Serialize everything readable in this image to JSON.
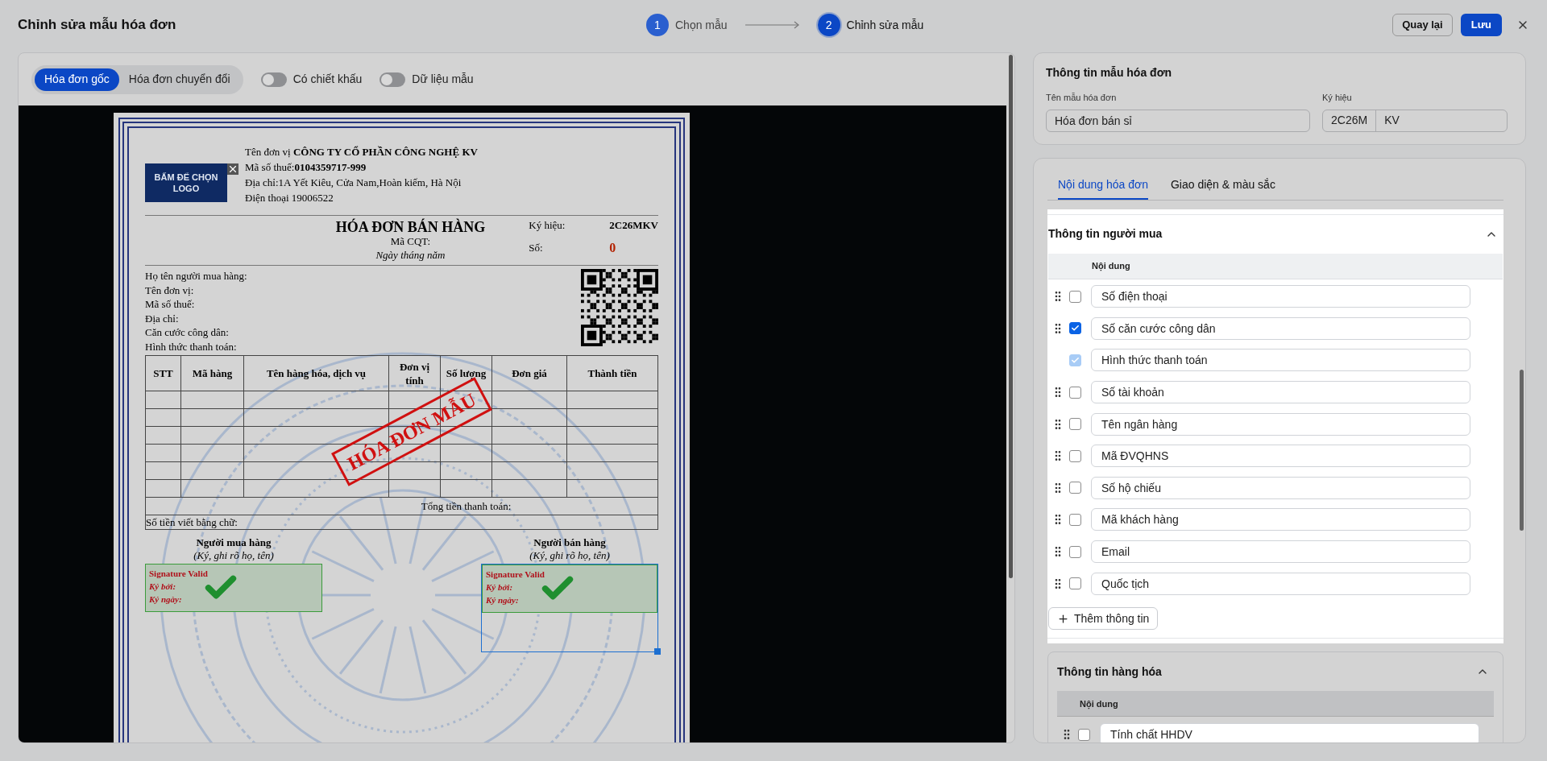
{
  "header": {
    "title": "Chỉnh sửa mẫu hóa đơn",
    "steps": [
      {
        "number": "1",
        "label": "Chọn mẫu",
        "selected": false
      },
      {
        "number": "2",
        "label": "Chỉnh sửa mẫu",
        "selected": true
      }
    ],
    "back_button": "Quay lại",
    "save_button": "Lưu"
  },
  "preview": {
    "modes": [
      {
        "label": "Hóa đơn gốc",
        "selected": true
      },
      {
        "label": "Hóa đơn chuyển đổi",
        "selected": false
      }
    ],
    "switches": [
      {
        "label": "Có chiết khấu",
        "on": false
      },
      {
        "label": "Dữ liệu mẫu",
        "on": false
      }
    ],
    "invoice": {
      "logo": "BẤM ĐỂ CHỌN LOGO",
      "seller_lines": [
        "Tên đơn vị **CÔNG TY CỔ PHẦN CÔNG NGHỆ KV**",
        "Mã số thuế:**0104359717-999**",
        "Địa chỉ:1A Yết Kiêu, Cửa Nam,Hoàn kiếm, Hà Nội",
        "Điện thoại 19006522"
      ],
      "title": "HÓA ĐƠN BÁN HÀNG",
      "tax_code": "Mã CQT:",
      "date": "Ngày tháng  năm",
      "symbol_label": "Ký hiệu:",
      "symbol_value": "2C26MKV",
      "number_label": "Số:",
      "number_value": "0",
      "buyer_lines": [
        "Họ tên người mua hàng:",
        "Tên đơn vị:",
        "Mã số thuế:",
        "Địa chỉ:",
        "Căn cước công dân:",
        "Hình thức thanh toán:"
      ],
      "columns": [
        "STT",
        "Mã hàng",
        "Tên hàng hóa, dịch vụ",
        "Đơn vị tính",
        "Số lượng",
        "Đơn giá",
        "Thành tiền"
      ],
      "stamp": "HÓA ĐƠN MẪU",
      "total_label": "Tổng tiền thanh toán:",
      "words_label": "Số tiền viết bằng chữ:",
      "signatures": [
        {
          "title": "Người mua hàng",
          "note": "(Ký, ghi rõ họ, tên)",
          "lines": [
            "Signature Valid",
            "Ký bởi:",
            "Ký ngày:"
          ],
          "selected": false
        },
        {
          "title": "Người bán hàng",
          "note": "(Ký, ghi rõ họ, tên)",
          "lines": [
            "Signature Valid",
            "Ký bởi:",
            "Ký ngày:"
          ],
          "selected": true
        }
      ]
    }
  },
  "template_info": {
    "title": "Thông tin mẫu hóa đơn",
    "name_label": "Tên mẫu hóa đơn",
    "name_value": "Hóa đơn bán sỉ",
    "symbol_label": "Ký hiệu",
    "symbol_parts": [
      "2C26M",
      "KV"
    ]
  },
  "content_tabs": [
    {
      "label": "Nội dung hóa đơn",
      "selected": true
    },
    {
      "label": "Giao diện & màu sắc",
      "selected": false
    }
  ],
  "sections": [
    {
      "title": "Thông tin người mua",
      "expanded": true,
      "highlighted": true,
      "column": "Nội dung",
      "add_button": "Thêm thông tin",
      "rows": [
        {
          "label": "Số điện thoại",
          "checked": false,
          "locked": false
        },
        {
          "label": "Số căn cước công dân",
          "checked": true,
          "locked": false
        },
        {
          "label": "Hình thức thanh toán",
          "checked": true,
          "locked": true
        },
        {
          "label": "Số tài khoản",
          "checked": false,
          "locked": false
        },
        {
          "label": "Tên ngân hàng",
          "checked": false,
          "locked": false
        },
        {
          "label": "Mã ĐVQHNS",
          "checked": false,
          "locked": false
        },
        {
          "label": "Số hộ chiếu",
          "checked": false,
          "locked": false
        },
        {
          "label": "Mã khách hàng",
          "checked": false,
          "locked": false
        },
        {
          "label": "Email",
          "checked": false,
          "locked": false
        },
        {
          "label": "Quốc tịch",
          "checked": false,
          "locked": false
        }
      ]
    },
    {
      "title": "Thông tin hàng hóa",
      "expanded": true,
      "highlighted": false,
      "column": "Nội dung",
      "rows": [
        {
          "label": "Tính chất HHDV",
          "checked": false,
          "locked": false
        }
      ]
    }
  ]
}
